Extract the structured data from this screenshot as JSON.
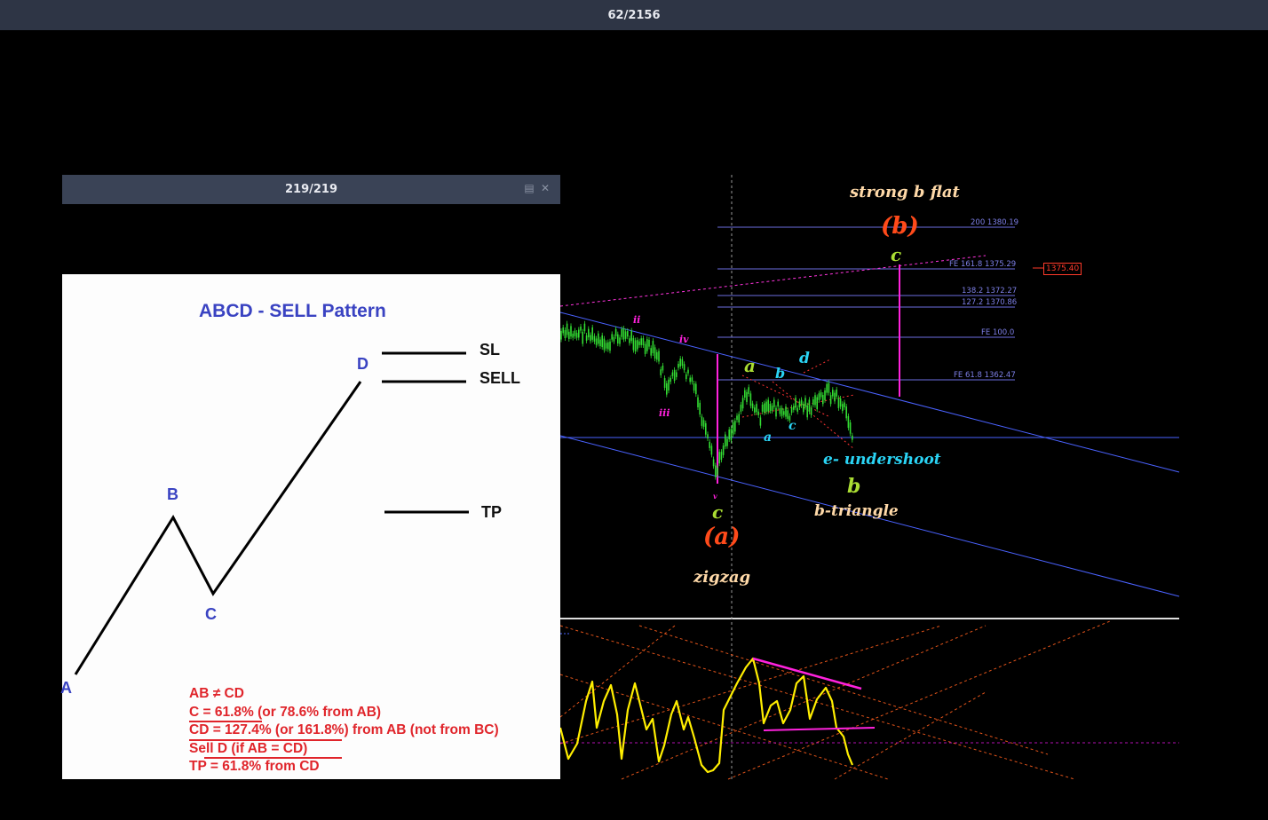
{
  "viewer": {
    "counter": "62/2156"
  },
  "inner_window": {
    "counter": "219/219",
    "restore_icon": "window-restore-icon",
    "close_icon": "close-icon"
  },
  "pattern": {
    "title": "ABCD - SELL Pattern",
    "points": {
      "A": "A",
      "B": "B",
      "C": "C",
      "D": "D"
    },
    "levels": {
      "sl": "SL",
      "sell": "SELL",
      "tp": "TP"
    },
    "rules": [
      "AB ≠ CD",
      "C = 61.8% (or 78.6% from AB)",
      "CD = 127.4% (or 161.8%) from AB (not from BC)",
      "Sell D (if AB = CD)",
      "TP = 61.8% from CD"
    ]
  },
  "chart": {
    "annotations": {
      "strong_b_flat": "strong b flat",
      "wave_b_paren": "(b)",
      "wave_c_top": "c",
      "wave_a_paren": "(a)",
      "zigzag": "zigzag",
      "wave_c_bottom": "c",
      "wave_b_green": "b",
      "b_triangle": "b-triangle",
      "e_undershoot": "e- undershoot",
      "tri_a_upper": "a",
      "tri_b": "b",
      "tri_d": "d",
      "tri_a_lower": "a",
      "tri_c": "c",
      "wave_ii": "ii",
      "wave_iv": "iv",
      "wave_iii": "iii",
      "wave_v": "v"
    },
    "fib_levels": [
      {
        "label": "200 1380.19"
      },
      {
        "label": "FE 161.8 1375.29"
      },
      {
        "label": "138.2 1372.27"
      },
      {
        "label": "127.2 1370.86"
      },
      {
        "label": "FE 100.0"
      },
      {
        "label": "FE 61.8 1362.47"
      }
    ],
    "price_tag": "1375.40",
    "colors": {
      "bullish": "#33dd33",
      "channel": "#4a62ff",
      "fib": "#7d7fe6",
      "oscillator": "#ffee00",
      "magenta": "#ff22dd",
      "grid_orange": "#e0531a",
      "text_blue": "#3a43c2",
      "text_red": "#e0252b"
    }
  }
}
